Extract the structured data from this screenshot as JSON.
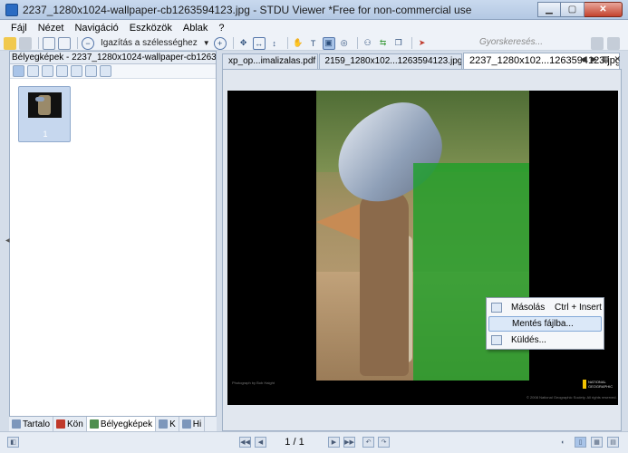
{
  "window": {
    "title": "2237_1280x1024-wallpaper-cb1263594123.jpg - STDU Viewer *Free for non-commercial use",
    "minimize_icon": "minimize-icon",
    "maximize_icon": "maximize-icon",
    "close_icon": "close-icon"
  },
  "menubar": {
    "items": [
      "Fájl",
      "Nézet",
      "Navigáció",
      "Eszközök",
      "Ablak",
      "?"
    ]
  },
  "toolbar": {
    "fit_width_label": "Igazítás a szélességhez",
    "search_placeholder": "Gyorskeresés..."
  },
  "left_panel": {
    "header": "Bélyegképek - 2237_1280x1024-wallpaper-cb1263594123.jpg",
    "thumbnail_number": "1",
    "tabs": [
      "Tartalo",
      "Kön",
      "Bélyegképek",
      "K",
      "Hi"
    ]
  },
  "doc_tabs": {
    "tabs": [
      "xp_op...imalizalas.pdf",
      "2159_1280x102...1263594123.jpg",
      "2237_1280x102...1263594123.jpg"
    ],
    "active_index": 2
  },
  "image": {
    "caption": "Photograph by Bob Haight",
    "brand": "NATIONAL GEOGRAPHIC",
    "copyright": "© 2008 National Geographic Society. All rights reserved."
  },
  "context_menu": {
    "items": [
      {
        "label": "Másolás",
        "shortcut": "Ctrl + Insert"
      },
      {
        "label": "Mentés fájlba...",
        "shortcut": ""
      },
      {
        "label": "Küldés...",
        "shortcut": ""
      }
    ],
    "highlighted_index": 1
  },
  "statusbar": {
    "page_indicator": "1 / 1"
  },
  "colors": {
    "titlebar": "#b3c8e3",
    "selection_green": "#1aa026",
    "close_button": "#c4432e"
  }
}
